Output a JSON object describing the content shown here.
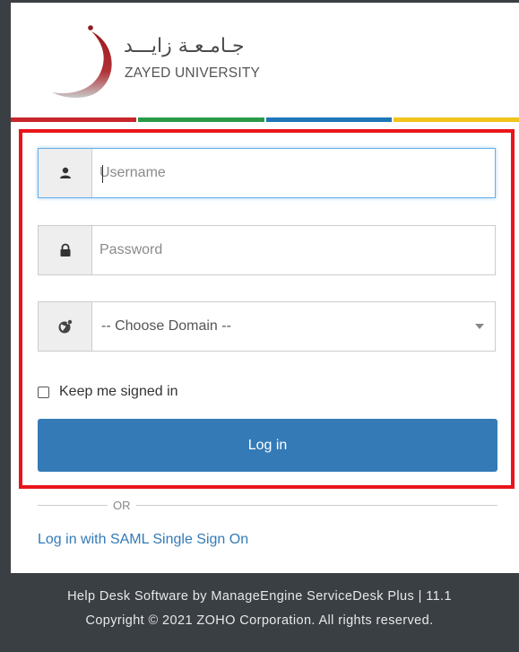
{
  "logo": {
    "arabic_text": "جـامـعـة زايـــد",
    "english_text": "ZAYED UNIVERSITY"
  },
  "color_bar": [
    "#c9262c",
    "#2b9a48",
    "#1f76b8",
    "#f2c31b"
  ],
  "form": {
    "username": {
      "placeholder": "Username",
      "icon": "user-icon"
    },
    "password": {
      "placeholder": "Password",
      "icon": "lock-icon"
    },
    "domain": {
      "selected": "-- Choose Domain --",
      "icon": "globe-icon"
    },
    "keep_signed_in_label": "Keep me signed in",
    "login_label": "Log in"
  },
  "divider_text": "OR",
  "saml_link": "Log in with SAML Single Sign On",
  "footer": {
    "line1": "Help Desk Software by ManageEngine ServiceDesk Plus | 11.1",
    "line2": "Copyright © 2021 ZOHO Corporation. All rights reserved."
  },
  "colors": {
    "primary": "#337ab7",
    "highlight_border": "#e8151b",
    "footer_bg": "#3a3f44"
  }
}
